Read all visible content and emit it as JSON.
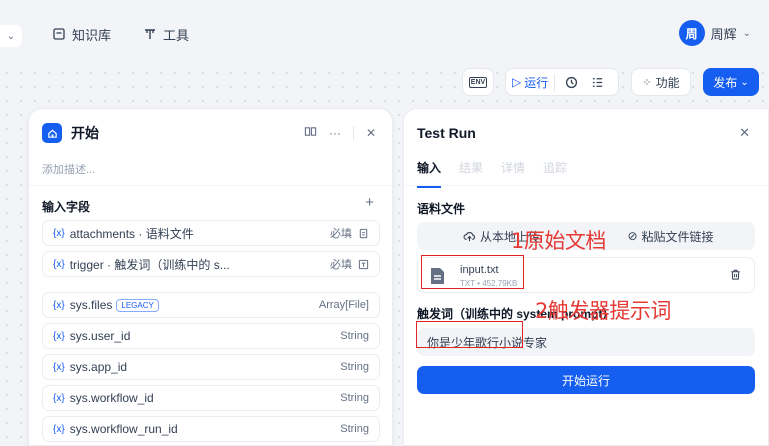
{
  "nav": {
    "knowledge": "知识库",
    "tools": "工具"
  },
  "user": {
    "avatar": "周",
    "name": "周辉"
  },
  "toolbar": {
    "env": "ENV",
    "run": "运行",
    "features": "功能",
    "publish": "发布"
  },
  "start_panel": {
    "title": "开始",
    "description_placeholder": "添加描述...",
    "fields_title": "输入字段",
    "fields": [
      {
        "name": "attachments · 语料文件",
        "right": "必填",
        "icon": "file-icon"
      },
      {
        "name": "trigger · 触发词（训练中的 s...",
        "right": "必填",
        "icon": "paragraph-icon"
      },
      {
        "name": "sys.files",
        "badge": "LEGACY",
        "right": "Array[File]"
      },
      {
        "name": "sys.user_id",
        "right": "String"
      },
      {
        "name": "sys.app_id",
        "right": "String"
      },
      {
        "name": "sys.workflow_id",
        "right": "String"
      },
      {
        "name": "sys.workflow_run_id",
        "right": "String"
      }
    ]
  },
  "test_run": {
    "title": "Test Run",
    "tabs": [
      "输入",
      "结果",
      "详情",
      "追踪"
    ],
    "corpus_label": "语料文件",
    "upload_local": "从本地上传",
    "paste_link": "粘贴文件链接",
    "file_name": "input.txt",
    "file_meta": "TXT • 452.79KB",
    "trigger_label": "触发词（训练中的 system prompt）",
    "trigger_value": "你是少年歌行小说专家",
    "start_button": "开始运行"
  },
  "annotations": {
    "label1": "1原始文档",
    "label2": "2触发器提示词"
  },
  "colors": {
    "accent": "#155eef",
    "annotation": "#e53935"
  }
}
